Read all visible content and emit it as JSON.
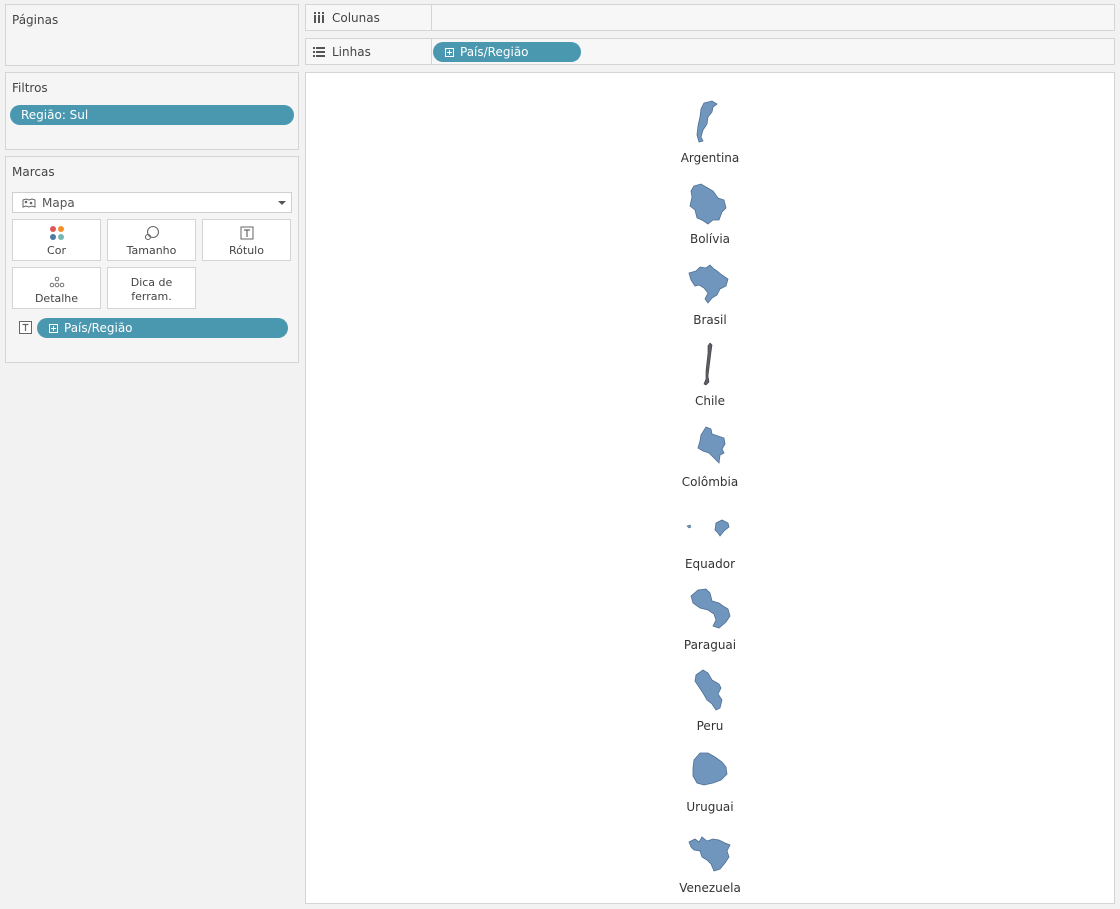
{
  "pages_panel": {
    "title": "Páginas"
  },
  "filters_panel": {
    "title": "Filtros",
    "filter_pill": "Região: Sul"
  },
  "marks_panel": {
    "title": "Marcas",
    "mark_type": "Mapa",
    "buttons": {
      "color": "Cor",
      "size": "Tamanho",
      "label": "Rótulo",
      "detail": "Detalhe",
      "tooltip_line1": "Dica de",
      "tooltip_line2": "ferram."
    },
    "field_pill": "País/Região"
  },
  "shelves": {
    "columns_label": "Colunas",
    "rows_label": "Linhas",
    "rows_pill": "País/Região"
  },
  "colors": {
    "pill": "#4a97b0",
    "map_fill": "#7096be",
    "map_stroke": "#4f6f93"
  },
  "countries": [
    {
      "name": "Argentina"
    },
    {
      "name": "Bolívia"
    },
    {
      "name": "Brasil"
    },
    {
      "name": "Chile"
    },
    {
      "name": "Colômbia"
    },
    {
      "name": "Equador"
    },
    {
      "name": "Paraguai"
    },
    {
      "name": "Peru"
    },
    {
      "name": "Uruguai"
    },
    {
      "name": "Venezuela"
    }
  ]
}
